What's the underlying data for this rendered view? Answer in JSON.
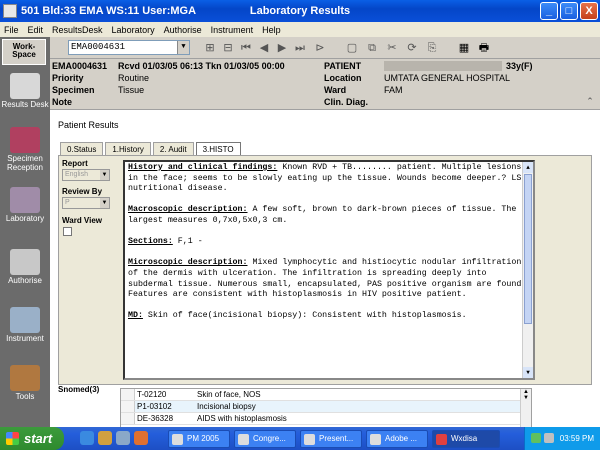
{
  "window": {
    "left_title": "501 Bld:33 EMA WS:11 User:MGA",
    "center_title": "Laboratory Results",
    "min": "_",
    "max": "□",
    "close": "X"
  },
  "menu": [
    "File",
    "Edit",
    "ResultsDesk",
    "Laboratory",
    "Authorise",
    "Instrument",
    "Help"
  ],
  "sidebar": {
    "workspace": "Work-Space",
    "items": [
      {
        "label": "Results Desk",
        "color": "#d8d8d8"
      },
      {
        "label": "Specimen Reception",
        "color": "#b04060"
      },
      {
        "label": "Laboratory",
        "color": "#a08ca8"
      },
      {
        "label": "Authorise",
        "color": "#c8c8c8"
      },
      {
        "label": "Instrument",
        "color": "#9ab0c8"
      },
      {
        "label": "Tools",
        "color": "#b07840"
      }
    ]
  },
  "toolbar": {
    "episode": "EMA0004631",
    "buttons": [
      "⊞",
      "⊟",
      "⏮",
      "◀",
      "▶",
      "⏭",
      "⊳",
      "▢",
      "⧉",
      "✂",
      "⟳",
      "⎘",
      "▦",
      "🖶"
    ]
  },
  "header": {
    "episode": "EMA0004631",
    "received": "Rcvd 01/03/05 06:13 Tkn 01/03/05 00:00",
    "priority_label": "Priority",
    "priority": "Routine",
    "specimen_label": "Specimen",
    "specimen": "Tissue",
    "note_label": "Note",
    "patient_label": "PATIENT",
    "patient_age": "33y(F)",
    "location_label": "Location",
    "location": "UMTATA GENERAL HOSPITAL",
    "ward_label": "Ward",
    "ward": "FAM",
    "clindiag_label": "Clin. Diag."
  },
  "panel": {
    "title": "Patient Results",
    "tabs": [
      {
        "label": "0.Status",
        "active": false
      },
      {
        "label": "1.History",
        "active": false
      },
      {
        "label": "2. Audit",
        "active": false
      },
      {
        "label": "3.HISTO",
        "active": true
      }
    ],
    "report_label": "Report",
    "report_value": "English",
    "reviewby_label": "Review By",
    "reviewby_value": "P",
    "wardview_label": "Ward View",
    "snomed_label": "Snomed(3)"
  },
  "report": {
    "history_h": "History and clinical findings:",
    "history_t": " Known RVD + TB........ patient. Multiple lesions in the face; seems to be slowly eating up the tissue. Wounds become deeper.? LS, nutritional disease.",
    "macro_h": "Macroscopic description:",
    "macro_t": " A few soft, brown to dark-brown pieces of tissue. The largest measures 0,7x0,5x0,3 cm.",
    "sections_h": "Sections:",
    "sections_t": " F,1 -",
    "micro_h": "Microscopic description:",
    "micro_t": " Mixed lymphocytic and histiocytic nodular infiltration of the dermis with ulceration. The infiltration is spreading deeply into subdermal tissue. Numerous small, encapsulated, PAS positive organism are found. Features are consistent with histoplasmosis in HIV positive patient.",
    "md_h": "MD:",
    "md_t": " Skin of face(incisional biopsy): Consistent with histoplasmosis."
  },
  "snomed": [
    {
      "code": "T-02120",
      "desc": "Skin of face, NOS"
    },
    {
      "code": "P1-03102",
      "desc": "Incisional biopsy"
    },
    {
      "code": "DE-36328",
      "desc": "AIDS with histoplasmosis"
    }
  ],
  "taskbar": {
    "start": "start",
    "tasks": [
      "PM 2005",
      "Congre...",
      "Present...",
      "Adobe ...",
      "Wxdisa"
    ],
    "clock": "03:59 PM"
  }
}
